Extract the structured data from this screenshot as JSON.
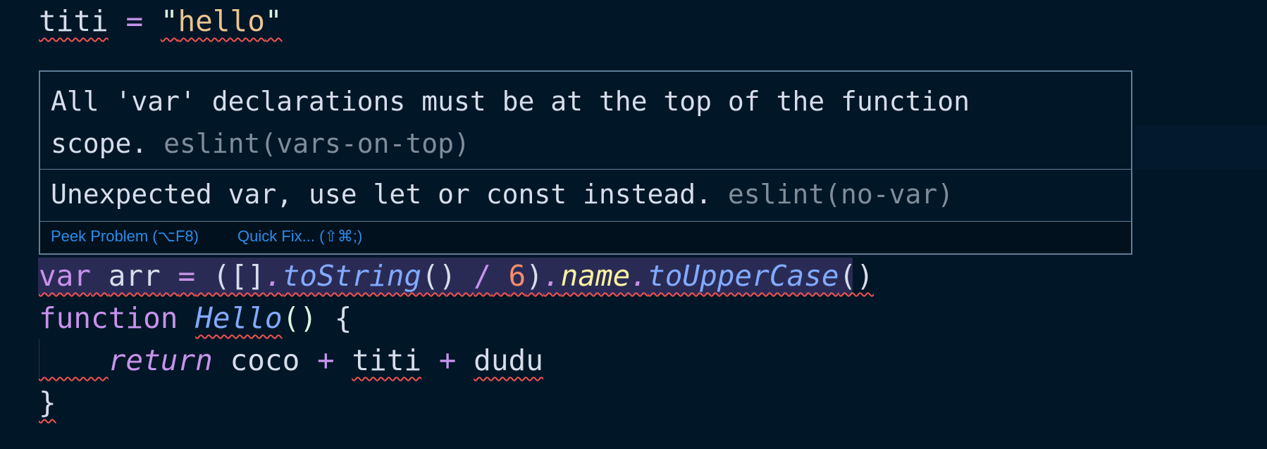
{
  "code": {
    "line1": {
      "var": "titi",
      "op": "=",
      "open_quote": "\"",
      "str": "hello",
      "close_quote": "\""
    },
    "line_var": {
      "kw": "var",
      "name": "arr",
      "op": "=",
      "p1": " ([]",
      "dot1": ".",
      "fn1": "toString",
      "p2": "() ",
      "div": "/",
      "num": "6",
      "p3": ")",
      "dot2": ".",
      "prop": "name",
      "dot3": ".",
      "fn2": "toUpperCase",
      "p4": "()"
    },
    "line_fn": {
      "kw": "function",
      "name": "Hello",
      "parens": "()",
      "brace": "{"
    },
    "line_return": {
      "kw": "return",
      "a": "coco",
      "plus1": "+",
      "b": "titi",
      "plus2": "+",
      "c": "dudu"
    },
    "line_close": {
      "brace": "}"
    }
  },
  "hover": {
    "problems": [
      {
        "message_line1": "All 'var' declarations must be at the top of the function",
        "message_line2": "scope.",
        "source": "eslint(vars-on-top)"
      },
      {
        "message": "Unexpected var, use let or const instead.",
        "source": "eslint(no-var)"
      }
    ],
    "actions": {
      "peek": "Peek Problem (⌥F8)",
      "quick_fix": "Quick Fix... (⇧⌘;)"
    }
  },
  "colors": {
    "background": "#011627",
    "keyword": "#c792ea",
    "string": "#ecc48d",
    "function": "#82aaff",
    "number": "#f78c6c",
    "property": "#faf39f",
    "error_squiggle": "#ef5350",
    "link": "#2a8ceb"
  }
}
